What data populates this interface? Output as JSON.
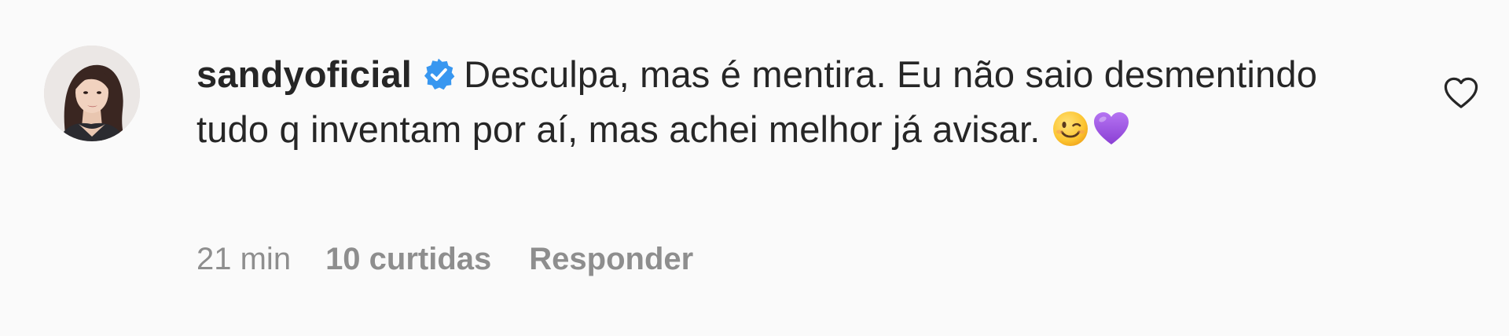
{
  "comment": {
    "username": "sandyoficial",
    "verified": true,
    "text": "Desculpa, mas é mentira. Eu não saio desmentindo tudo q inventam por aí, mas achei melhor já avisar.",
    "emojis": [
      "winking-face",
      "purple-heart"
    ],
    "timestamp": "21 min",
    "likes": "10 curtidas",
    "reply_label": "Responder"
  },
  "icons": {
    "verified": "verified-badge-icon",
    "like": "heart-outline-icon"
  },
  "colors": {
    "background": "#fafafa",
    "text": "#262626",
    "meta": "#8e8e8e",
    "verified": "#3897f0",
    "purple_heart": "#9b4fe0"
  }
}
